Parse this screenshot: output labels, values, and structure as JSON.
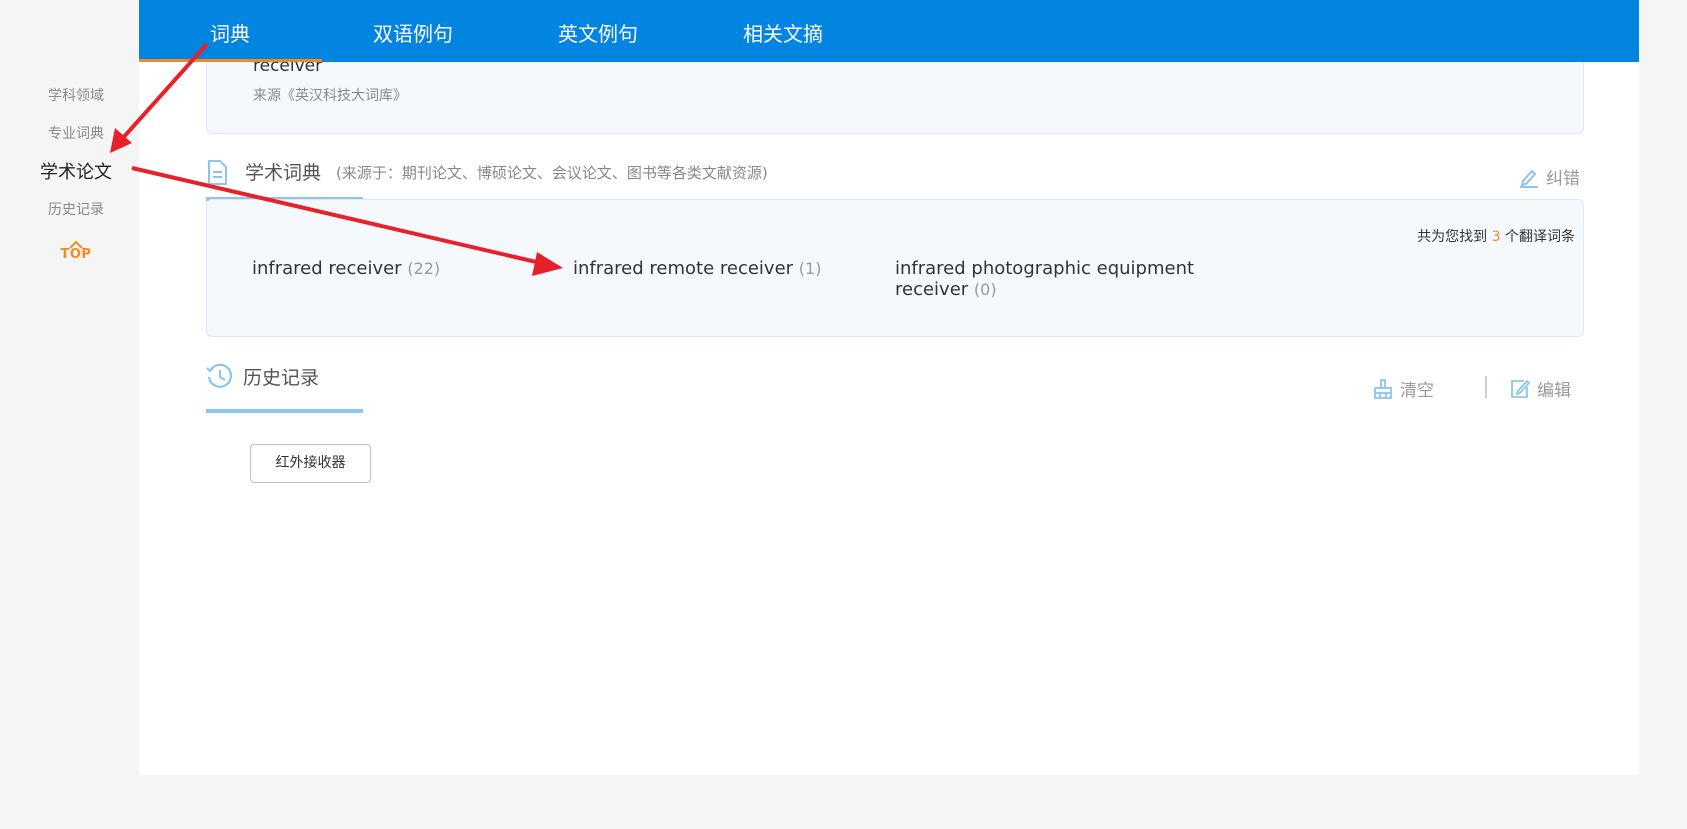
{
  "side_nav": {
    "items": [
      "学科领域",
      "专业词典",
      "学术论文",
      "历史记录"
    ],
    "active": "学术论文",
    "top_label": "TOP"
  },
  "tabs": [
    "词典",
    "双语例句",
    "英文例句",
    "相关文摘"
  ],
  "top_card": {
    "word": "receiver",
    "source": "来源《英汉科技大词库》"
  },
  "academic": {
    "title": "学术词典",
    "subtitle": "(来源于：期刊论文、博硕论文、会议论文、图书等各类文献资源)",
    "correct_label": "纠错",
    "found_prefix": "共为您找到",
    "found_count": "3",
    "found_suffix": "个翻译词条",
    "terms": [
      {
        "text": "infrared receiver",
        "count": "(22)"
      },
      {
        "text": "infrared remote receiver",
        "count": "(1)"
      },
      {
        "text": "infrared photographic equipment",
        "text2": "receiver",
        "count": "(0)"
      }
    ]
  },
  "history": {
    "title": "历史记录",
    "clear_label": "清空",
    "edit_label": "编辑",
    "items": [
      "红外接收器"
    ]
  },
  "colors": {
    "tab_bar": "#0284e1",
    "accent_orange": "#f08a24",
    "section_bar": "#8ec5ee",
    "card_bg": "#f5f9fd",
    "annotation_red": "#e8202a"
  }
}
